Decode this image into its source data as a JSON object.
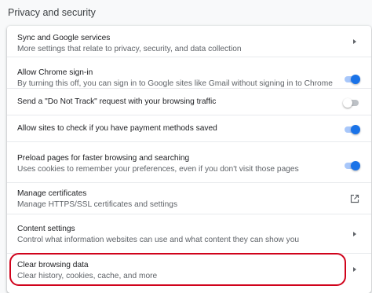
{
  "section_title": "Privacy and security",
  "accent_color": "#1a73e8",
  "highlight_color": "#d0021b",
  "rows": [
    {
      "label": "Sync and Google services",
      "sub": "More settings that relate to privacy, security, and data collection",
      "control": "arrow-icon"
    },
    {
      "label": "Allow Chrome sign-in",
      "sub": "By turning this off, you can sign in to Google sites like Gmail without signing in to Chrome",
      "control": "toggle",
      "on": true
    },
    {
      "label": "Send a \"Do Not Track\" request with your browsing traffic",
      "control": "toggle",
      "on": false
    },
    {
      "label": "Allow sites to check if you have payment methods saved",
      "control": "toggle",
      "on": true
    },
    {
      "label": "Preload pages for faster browsing and searching",
      "sub": "Uses cookies to remember your preferences, even if you don't visit those pages",
      "control": "toggle",
      "on": true
    },
    {
      "label": "Manage certificates",
      "sub": "Manage HTTPS/SSL certificates and settings",
      "control": "external-link-icon"
    },
    {
      "label": "Content settings",
      "sub": "Control what information websites can use and what content they can show you",
      "control": "arrow-icon"
    },
    {
      "label": "Clear browsing data",
      "sub": "Clear history, cookies, cache, and more",
      "control": "arrow-icon",
      "highlighted": true
    }
  ]
}
